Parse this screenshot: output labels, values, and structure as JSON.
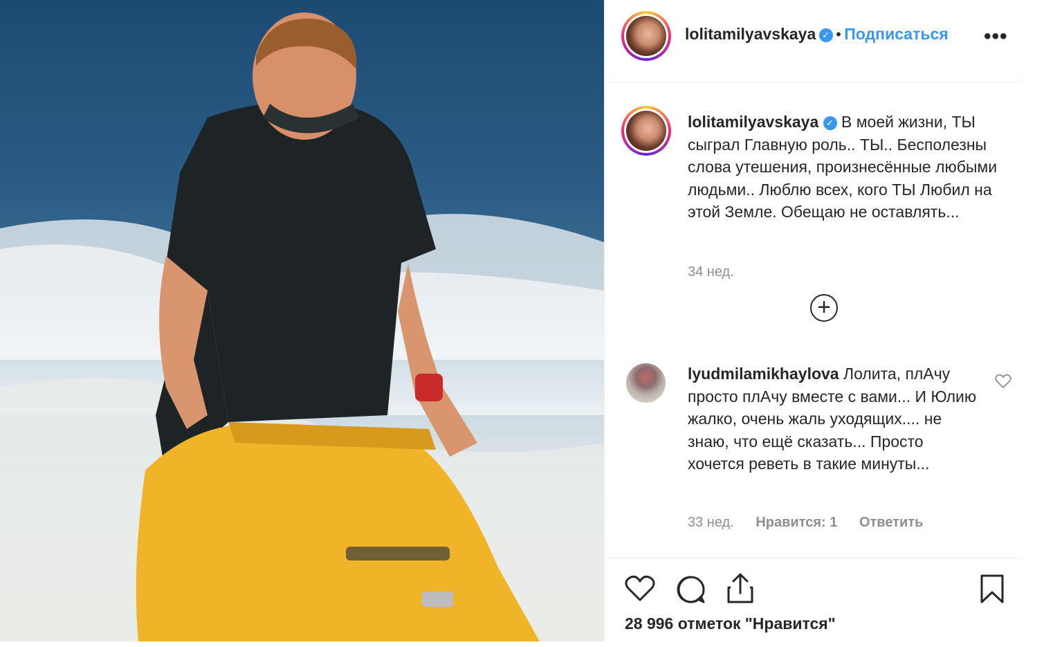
{
  "post": {
    "author": {
      "username": "lolitamilyavskaya",
      "verified": true,
      "follow_label": "Подписаться",
      "separator": "•",
      "more_label": "•••"
    },
    "caption": {
      "username": "lolitamilyavskaya",
      "text": "В моей жизни, ТЫ сыграл Главную роль.. ТЫ.. Бесполезны слова утешения, произнесённые любыми людьми.. Люблю всех, кого ТЫ Любил на этой Земле. Обещаю не оставлять...",
      "time": "34 нед."
    },
    "load_more_icon": "plus-circle-icon",
    "comments": [
      {
        "username": "lyudmilamikhaylova",
        "text": "Лолита, плАчу просто плАчу вместе с вами... И Юлию жалко, очень жаль уходящих.... не знаю, что ещё сказать... Просто хочется реветь в такие минуты...",
        "time": "33 нед.",
        "likes_label": "Нравится: 1",
        "reply_label": "Ответить"
      }
    ],
    "actions": {
      "icons": [
        "heart-icon",
        "comment-icon",
        "share-icon",
        "bookmark-icon"
      ]
    },
    "likes_text": "28 996 отметок \"Нравится\""
  },
  "colors": {
    "accent": "#3897f0",
    "text": "#262626",
    "muted": "#8e8e8e",
    "border": "#efefef"
  }
}
